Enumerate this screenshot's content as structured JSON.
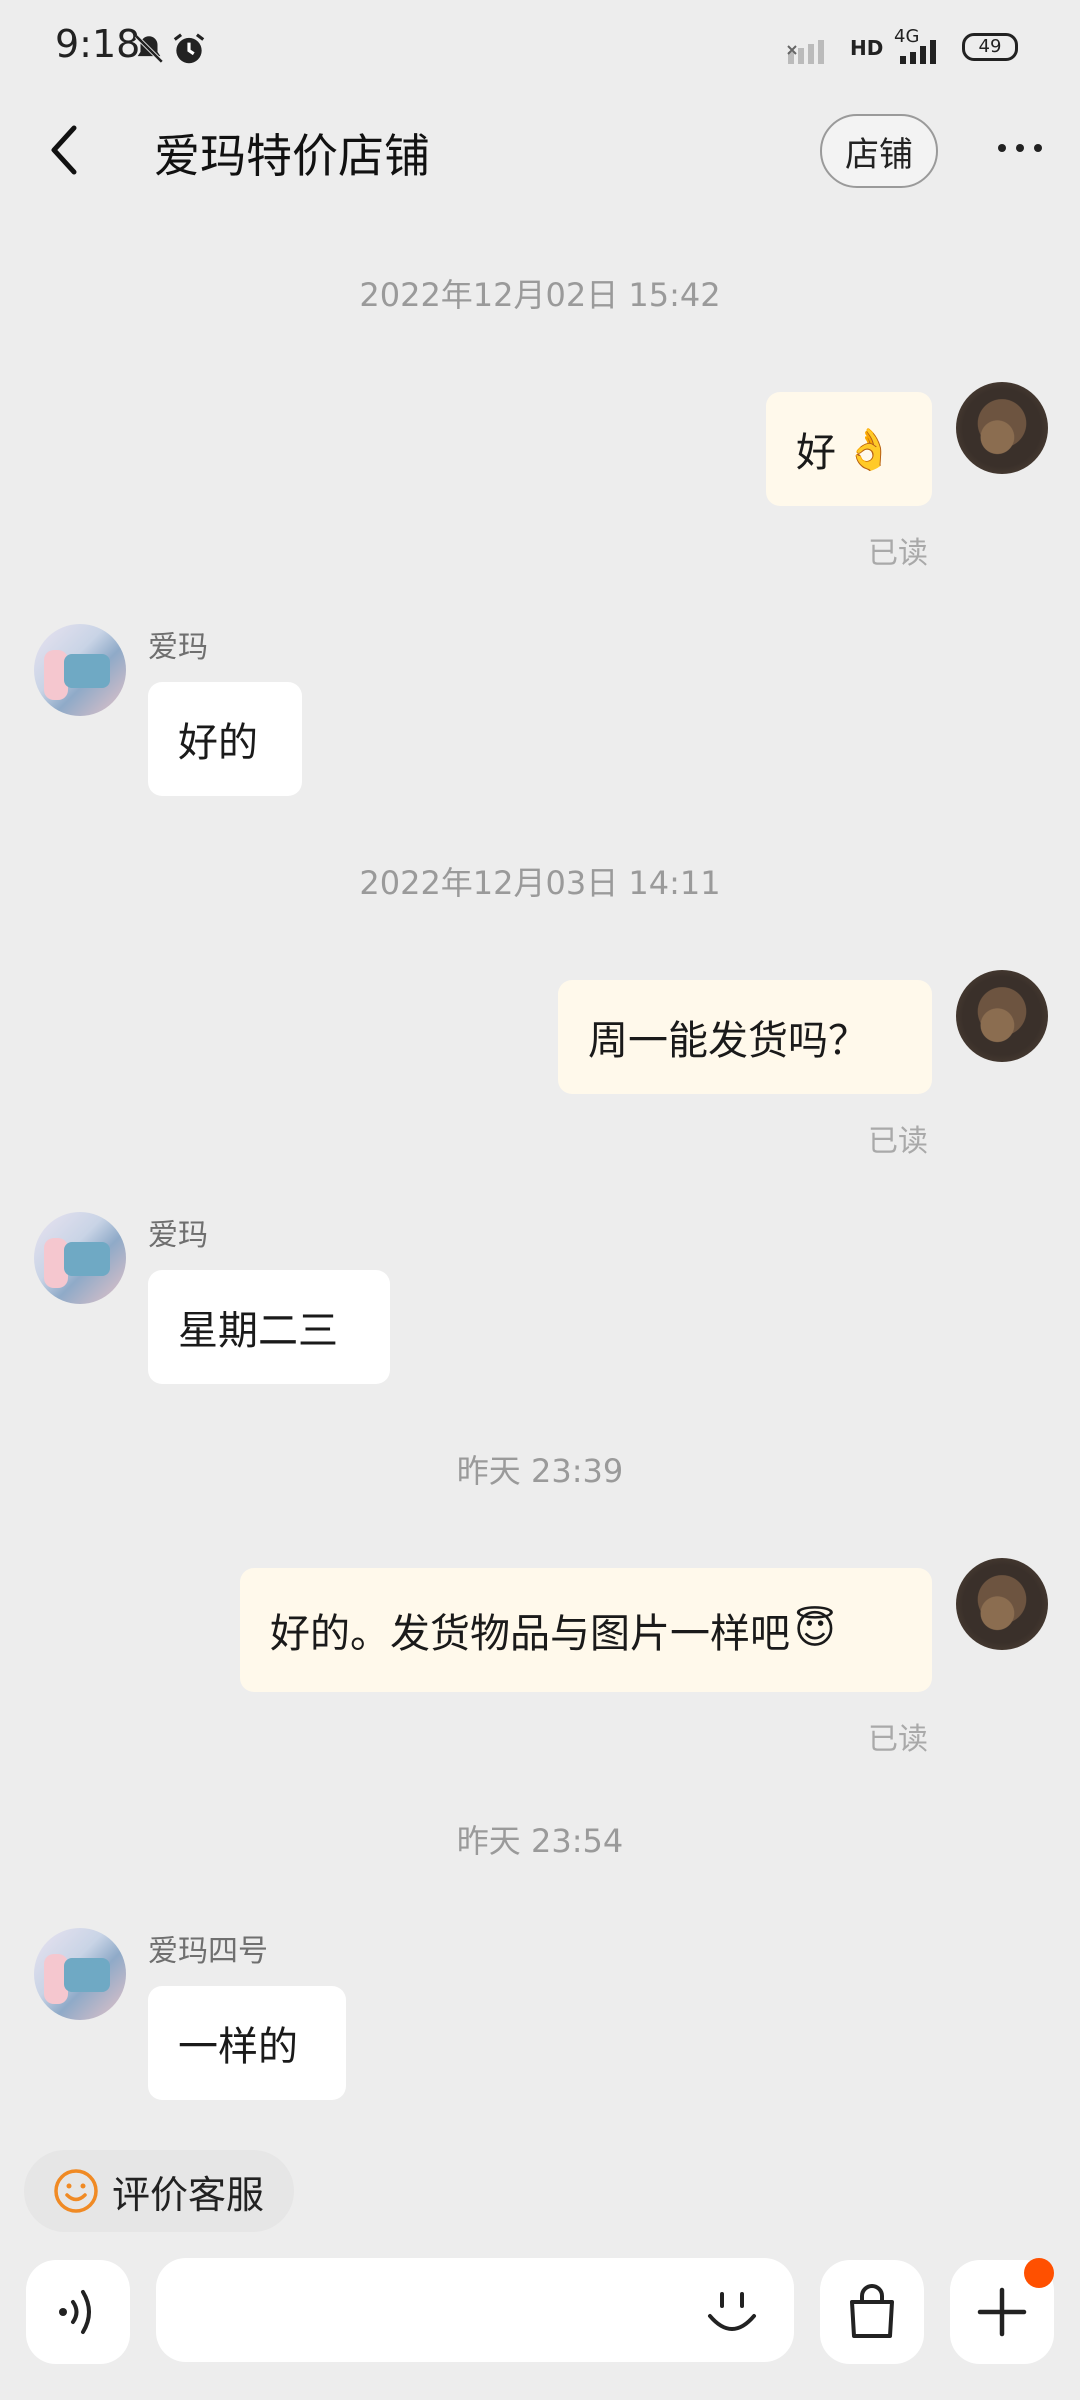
{
  "status_bar": {
    "time": "9:18",
    "network_label": "HD",
    "network_type": "4G",
    "battery_level": "49"
  },
  "header": {
    "title": "爱玛特价店铺",
    "shop_button": "店铺"
  },
  "messages": [
    {
      "type": "timestamp",
      "text": "2022年12月02日 15:42"
    },
    {
      "type": "me",
      "text": "好",
      "emoji": "👌",
      "read": "已读"
    },
    {
      "type": "them",
      "sender": "爱玛",
      "text": "好的"
    },
    {
      "type": "timestamp",
      "text": "2022年12月03日 14:11"
    },
    {
      "type": "me",
      "text": "周一能发货吗？",
      "read": "已读"
    },
    {
      "type": "them",
      "sender": "爱玛",
      "text": "星期二三"
    },
    {
      "type": "timestamp",
      "text": "昨天 23:39"
    },
    {
      "type": "me",
      "text": "好的。发货物品与图片一样吧",
      "emoji": "😇",
      "read": "已读"
    },
    {
      "type": "timestamp",
      "text": "昨天 23:54"
    },
    {
      "type": "them",
      "sender": "爱玛四号",
      "text": "一样的"
    }
  ],
  "rate_service": {
    "label": "评价客服"
  },
  "colors": {
    "background": "#EDEDED",
    "my_bubble": "#FFF9EB",
    "their_bubble": "#FFFFFF",
    "accent": "#FF5000",
    "rate_icon": "#F08A24"
  },
  "icons": [
    "back-arrow-icon",
    "more-icon",
    "voice-icon",
    "emoji-icon",
    "shopping-bag-icon",
    "plus-icon",
    "smiley-icon"
  ]
}
